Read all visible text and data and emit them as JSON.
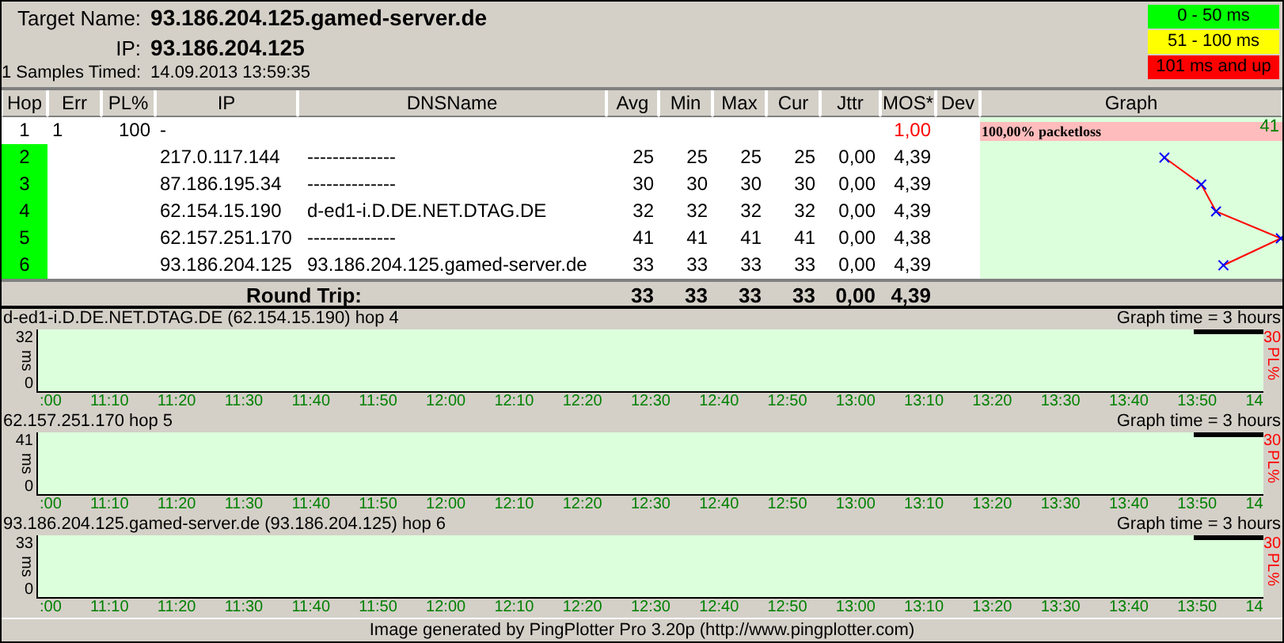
{
  "target": {
    "name_label": "Target Name:",
    "name": "93.186.204.125.gamed-server.de",
    "ip_label": "IP:",
    "ip": "93.186.204.125",
    "samples_label": "1 Samples Timed:",
    "timestamp": "14.09.2013 13:59:35"
  },
  "legend": [
    {
      "label": "0 - 50 ms",
      "color": "#00ff00"
    },
    {
      "label": "51 - 100 ms",
      "color": "#ffff00"
    },
    {
      "label": "101 ms and up",
      "color": "#ff0000"
    }
  ],
  "table": {
    "columns": [
      "Hop",
      "Err",
      "PL%",
      "IP",
      "DNSName",
      "Avg",
      "Min",
      "Max",
      "Cur",
      "Jttr",
      "MOS*",
      "Dev",
      "Graph"
    ],
    "rows": [
      {
        "hop": "1",
        "color": "#ffffff",
        "err": "1",
        "pl": "100",
        "ip": "-",
        "mos": "1,00",
        "lost": true
      },
      {
        "hop": "2",
        "color": "#00ff00",
        "ip": "217.0.117.144",
        "dns": "--------------",
        "avg": "25",
        "min": "25",
        "max": "25",
        "cur": "25",
        "jttr": "0,00",
        "mos": "4,39",
        "lost": false
      },
      {
        "hop": "3",
        "color": "#00ff00",
        "ip": "87.186.195.34",
        "dns": "--------------",
        "avg": "30",
        "min": "30",
        "max": "30",
        "cur": "30",
        "jttr": "0,00",
        "mos": "4,39",
        "lost": false
      },
      {
        "hop": "4",
        "color": "#00ff00",
        "ip": "62.154.15.190",
        "dns": "d-ed1-i.D.DE.NET.DTAG.DE",
        "avg": "32",
        "min": "32",
        "max": "32",
        "cur": "32",
        "jttr": "0,00",
        "mos": "4,39",
        "lost": false
      },
      {
        "hop": "5",
        "color": "#00ff00",
        "ip": "62.157.251.170",
        "dns": "--------------",
        "avg": "41",
        "min": "41",
        "max": "41",
        "cur": "41",
        "jttr": "0,00",
        "mos": "4,38",
        "lost": false
      },
      {
        "hop": "6",
        "color": "#00ff00",
        "ip": "93.186.204.125",
        "dns": "93.186.204.125.gamed-server.de",
        "avg": "33",
        "min": "33",
        "max": "33",
        "cur": "33",
        "jttr": "0,00",
        "mos": "4,39",
        "lost": false
      }
    ],
    "round_trip": {
      "label": "Round Trip:",
      "values": [
        "33",
        "33",
        "33",
        "33",
        "0,00",
        "4,39"
      ]
    },
    "graph": {
      "scale_max": "41",
      "loss_label": "100,00% packetloss"
    }
  },
  "hop_graphs": [
    {
      "title": "d-ed1-i.D.DE.NET.DTAG.DE (62.154.15.190) hop 4",
      "graph_time": "Graph time = 3 hours",
      "y_max": "32",
      "y_unit": "ms",
      "y_min": "0",
      "pl_max": "30",
      "pl_label": "PL%",
      "x_ticks": [
        ":00",
        "11:10",
        "11:20",
        "11:30",
        "11:40",
        "11:50",
        "12:00",
        "12:10",
        "12:20",
        "12:30",
        "12:40",
        "12:50",
        "13:00",
        "13:10",
        "13:20",
        "13:30",
        "13:40",
        "13:50",
        "14"
      ]
    },
    {
      "title": "62.157.251.170 hop 5",
      "graph_time": "Graph time = 3 hours",
      "y_max": "41",
      "y_unit": "ms",
      "y_min": "0",
      "pl_max": "30",
      "pl_label": "PL%",
      "x_ticks": [
        ":00",
        "11:10",
        "11:20",
        "11:30",
        "11:40",
        "11:50",
        "12:00",
        "12:10",
        "12:20",
        "12:30",
        "12:40",
        "12:50",
        "13:00",
        "13:10",
        "13:20",
        "13:30",
        "13:40",
        "13:50",
        "14"
      ]
    },
    {
      "title": "93.186.204.125.gamed-server.de (93.186.204.125) hop 6",
      "graph_time": "Graph time = 3 hours",
      "y_max": "33",
      "y_unit": "ms",
      "y_min": "0",
      "pl_max": "30",
      "pl_label": "PL%",
      "x_ticks": [
        ":00",
        "11:10",
        "11:20",
        "11:30",
        "11:40",
        "11:50",
        "12:00",
        "12:10",
        "12:20",
        "12:30",
        "12:40",
        "12:50",
        "13:00",
        "13:10",
        "13:20",
        "13:30",
        "13:40",
        "13:50",
        "14"
      ]
    }
  ],
  "footer": "Image generated by PingPlotter Pro 3.20p (http://www.pingplotter.com)"
}
